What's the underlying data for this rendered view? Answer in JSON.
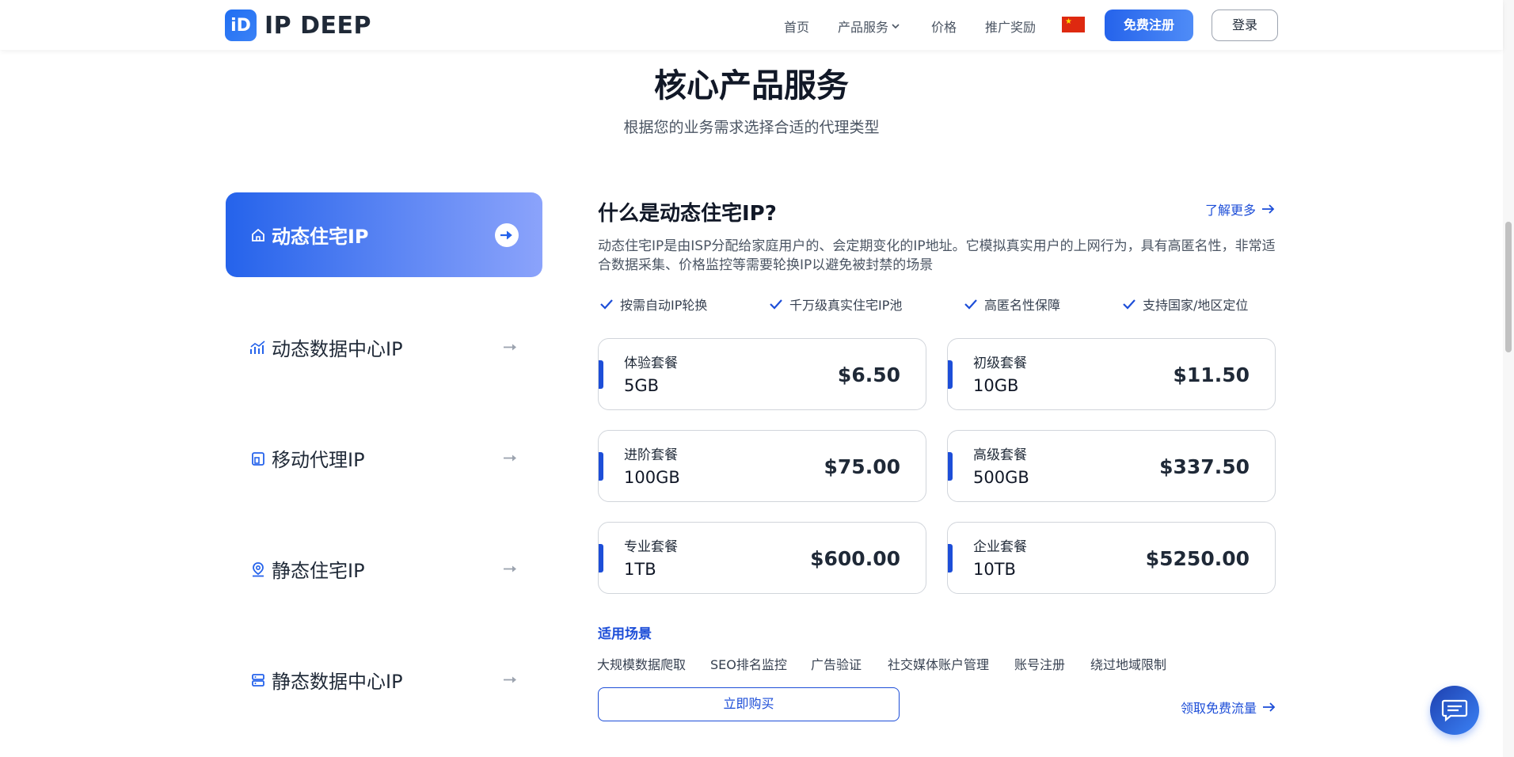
{
  "header": {
    "logo_mark": "iD",
    "logo_text": "IP DEEP",
    "nav": [
      "首页",
      "产品服务",
      "价格",
      "推广奖励"
    ],
    "register_label": "免费注册",
    "login_label": "登录"
  },
  "section": {
    "title": "核心产品服务",
    "subtitle": "根据您的业务需求选择合适的代理类型"
  },
  "tabs": [
    {
      "label": "动态住宅IP",
      "icon": "home-icon",
      "active": true
    },
    {
      "label": "动态数据中心IP",
      "icon": "chart-icon",
      "active": false
    },
    {
      "label": "移动代理IP",
      "icon": "mobile-icon",
      "active": false
    },
    {
      "label": "静态住宅IP",
      "icon": "location-pin-icon",
      "active": false
    },
    {
      "label": "静态数据中心IP",
      "icon": "server-icon",
      "active": false
    }
  ],
  "detail": {
    "title": "什么是动态住宅IP?",
    "learn_more": "了解更多",
    "description": "动态住宅IP是由ISP分配给家庭用户的、会定期变化的IP地址。它模拟真实用户的上网行为，具有高匿名性，非常适合数据采集、价格监控等需要轮换IP以避免被封禁的场景",
    "features": [
      "按需自动IP轮换",
      "千万级真实住宅IP池",
      "高匿名性保障",
      "支持国家/地区定位"
    ],
    "plans": [
      {
        "name": "体验套餐",
        "size": "5GB",
        "price": "$6.50"
      },
      {
        "name": "初级套餐",
        "size": "10GB",
        "price": "$11.50"
      },
      {
        "name": "进阶套餐",
        "size": "100GB",
        "price": "$75.00"
      },
      {
        "name": "高级套餐",
        "size": "500GB",
        "price": "$337.50"
      },
      {
        "name": "专业套餐",
        "size": "1TB",
        "price": "$600.00"
      },
      {
        "name": "企业套餐",
        "size": "10TB",
        "price": "$5250.00"
      }
    ],
    "scenes_title": "适用场景",
    "scenes": [
      "大规模数据爬取",
      "SEO排名监控",
      "广告验证",
      "社交媒体账户管理",
      "账号注册",
      "绕过地域限制"
    ],
    "buy_label": "立即购买",
    "free_flow": "领取免费流量"
  },
  "colors": {
    "accent": "#2563eb",
    "link": "#1d4ed8"
  }
}
